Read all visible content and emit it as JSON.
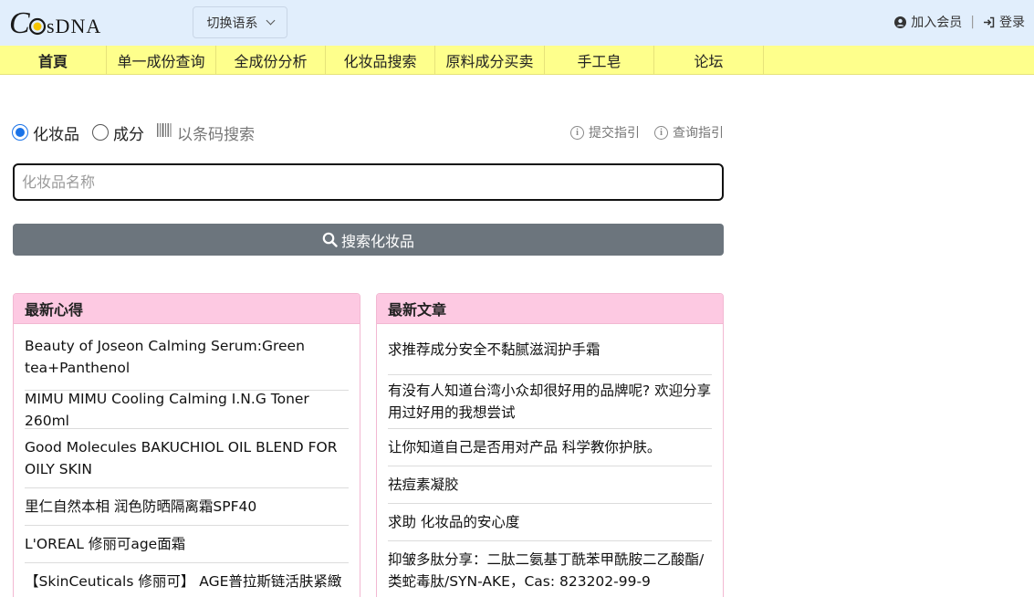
{
  "header": {
    "logo_text": "CosDNA",
    "lang_button": "切换语系",
    "join_label": "加入会员",
    "login_label": "登录"
  },
  "nav": {
    "items": [
      {
        "label": "首頁"
      },
      {
        "label": "单一成份查询"
      },
      {
        "label": "全成份分析"
      },
      {
        "label": "化妆品搜索"
      },
      {
        "label": "原料成分买卖"
      },
      {
        "label": "手工皂"
      },
      {
        "label": "论坛"
      }
    ]
  },
  "search": {
    "option_cosmetic": "化妆品",
    "option_ingredient": "成分",
    "option_barcode": "以条码搜索",
    "guide_submit": "提交指引",
    "guide_query": "查询指引",
    "placeholder": "化妆品名称",
    "button_label": "搜索化妆品"
  },
  "panels": {
    "reviews": {
      "title": "最新心得",
      "items": [
        {
          "text": "Beauty of Joseon Calming Serum:Green tea+Panthenol"
        },
        {
          "text": "MIMU MIMU Cooling Calming I.N.G Toner 260ml"
        },
        {
          "text": "Good Molecules BAKUCHIOL OIL BLEND FOR OILY SKIN"
        },
        {
          "text": "里仁自然本相 润色防晒隔离霜SPF40"
        },
        {
          "text": "L'OREAL 修丽可age面霜"
        },
        {
          "text": "【SkinCeuticals 修丽可】 AGE普拉斯链活肤紧緻"
        }
      ]
    },
    "articles": {
      "title": "最新文章",
      "items": [
        {
          "text": "求推荐成分安全不黏腻滋润护手霜"
        },
        {
          "text": "有没有人知道台湾小众却很好用的品牌呢? 欢迎分享用过好用的我想尝试"
        },
        {
          "text": "让你知道自己是否用对产品 科学教你护肤。"
        },
        {
          "text": "祛痘素凝胶"
        },
        {
          "text": "求助 化妆品的安心度"
        },
        {
          "text": "抑皱多肽分享：二肽二氨基丁酰苯甲酰胺二乙酸酯/类蛇毒肽/SYN-AKE，Cas: 823202-99-9"
        }
      ]
    }
  },
  "colors": {
    "topbar": "#e1eefc",
    "nav": "#feff8c",
    "panel_header": "#fdc9e2",
    "search_button": "#6c757d",
    "radio_accent": "#1a73e8"
  }
}
